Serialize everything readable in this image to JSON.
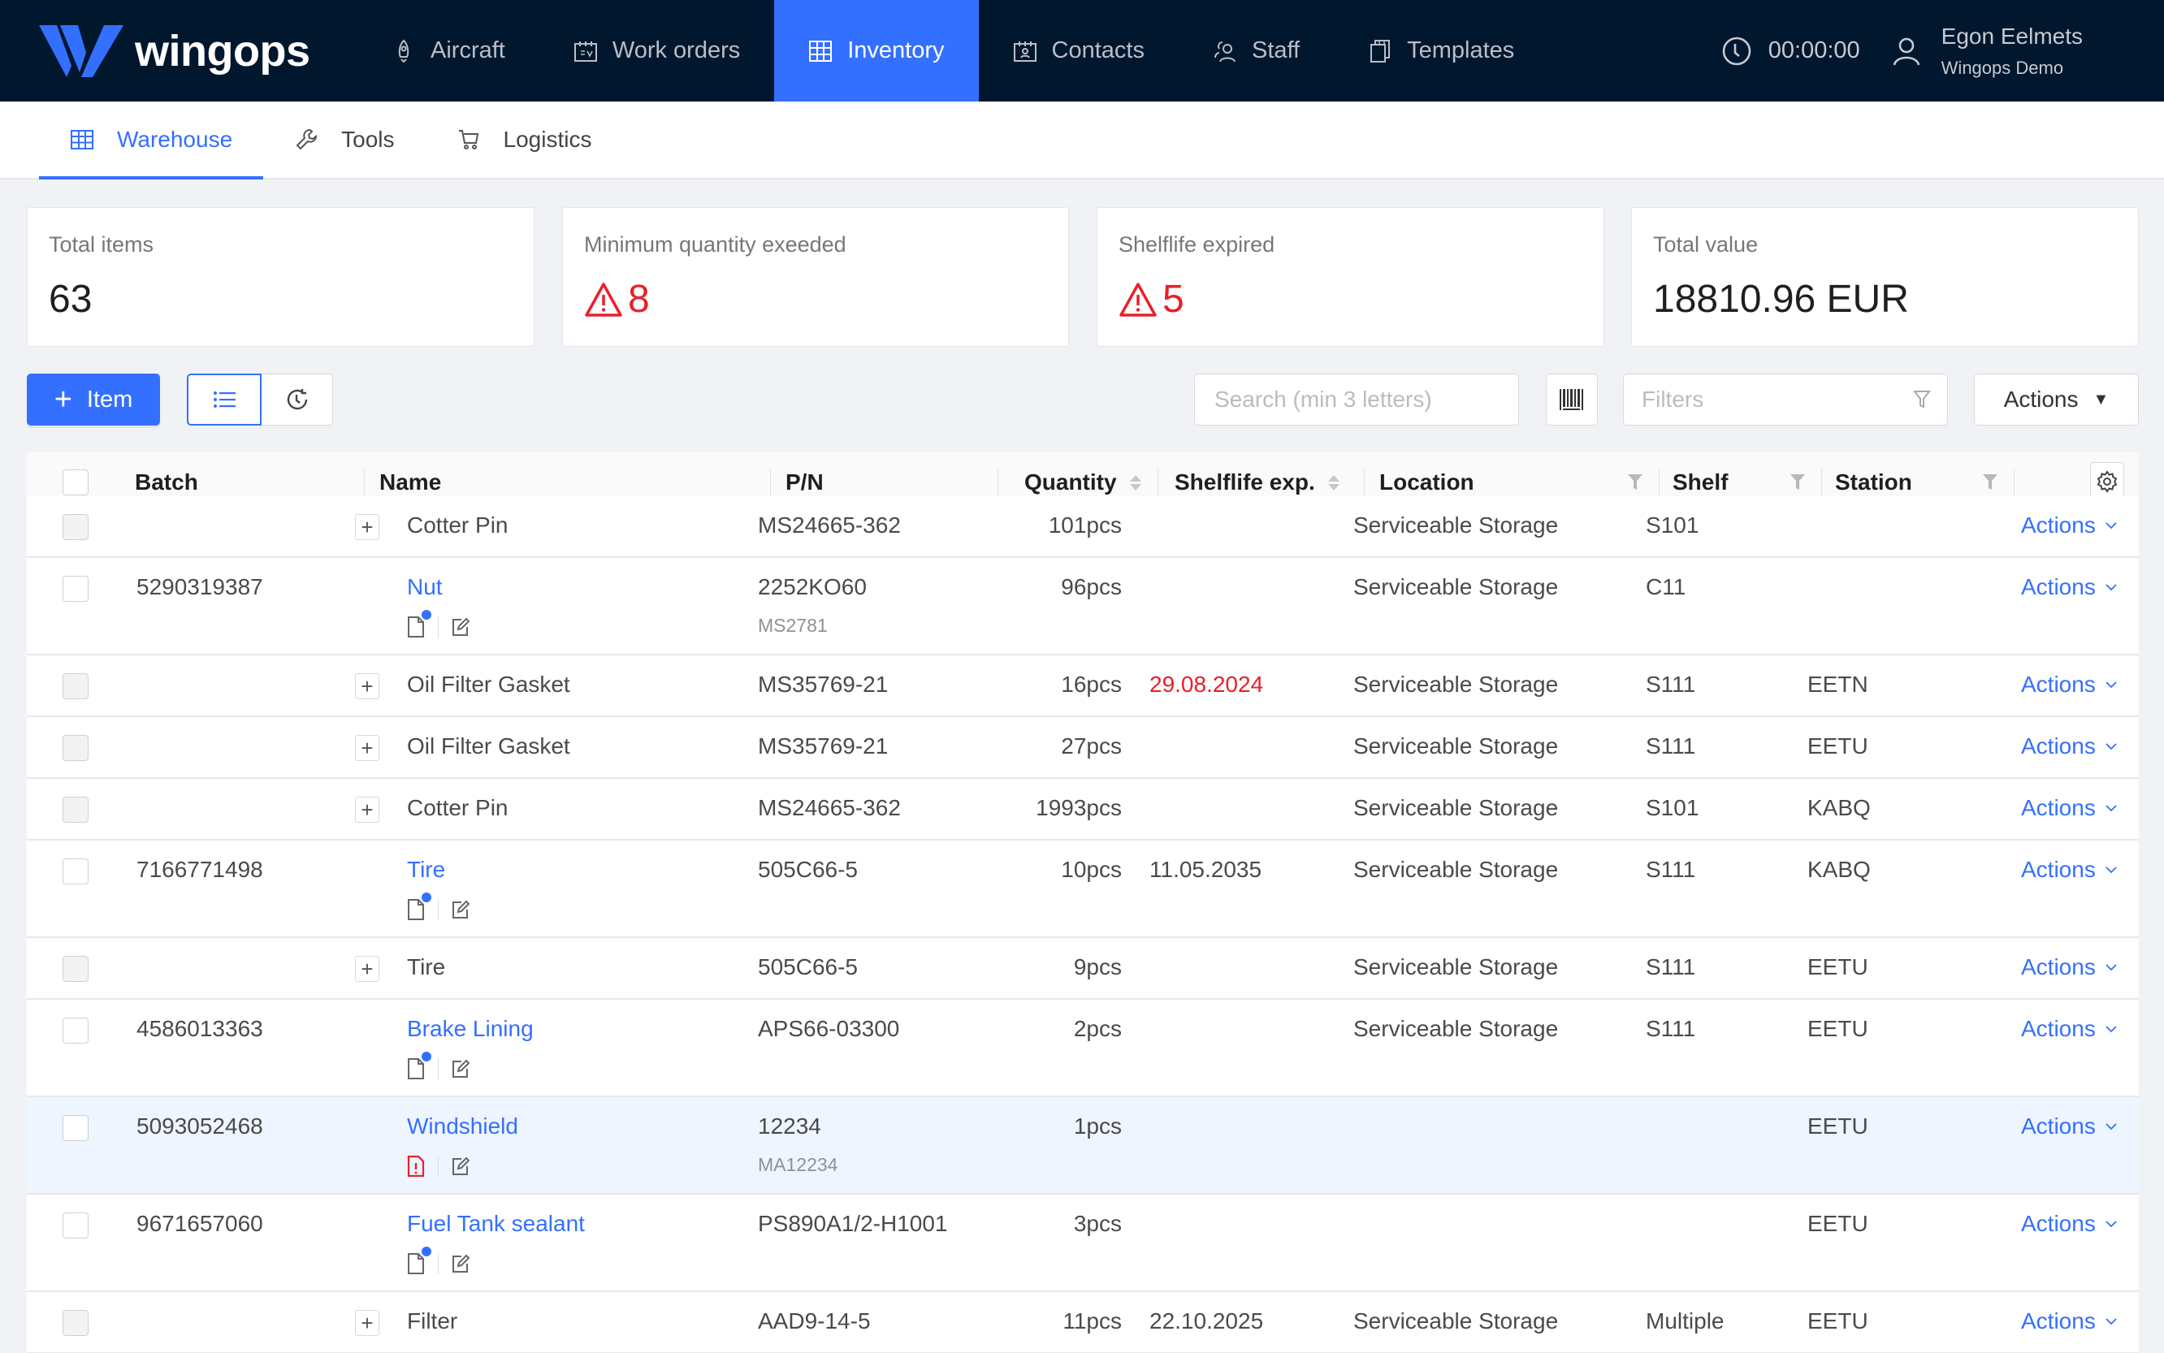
{
  "header": {
    "brand": "wingops",
    "nav": [
      {
        "label": "Aircraft",
        "icon": "rocket-icon",
        "active": false
      },
      {
        "label": "Work orders",
        "icon": "calendar-icon",
        "active": false
      },
      {
        "label": "Inventory",
        "icon": "grid-icon",
        "active": true
      },
      {
        "label": "Contacts",
        "icon": "contact-card-icon",
        "active": false
      },
      {
        "label": "Staff",
        "icon": "users-icon",
        "active": false
      },
      {
        "label": "Templates",
        "icon": "copy-icon",
        "active": false
      }
    ],
    "timer": "00:00:00",
    "user": {
      "name": "Egon Eelmets",
      "org": "Wingops Demo"
    }
  },
  "subtabs": [
    {
      "label": "Warehouse",
      "icon": "grid-icon",
      "active": true
    },
    {
      "label": "Tools",
      "icon": "wrench-icon",
      "active": false
    },
    {
      "label": "Logistics",
      "icon": "cart-icon",
      "active": false
    }
  ],
  "cards": [
    {
      "label": "Total items",
      "value": "63",
      "warning": false
    },
    {
      "label": "Minimum quantity exeeded",
      "value": "8",
      "warning": true
    },
    {
      "label": "Shelflife expired",
      "value": "5",
      "warning": true
    },
    {
      "label": "Total value",
      "value": "18810.96 EUR",
      "warning": false
    }
  ],
  "toolbar": {
    "add_item_label": "Item",
    "search_placeholder": "Search (min 3 letters)",
    "filters_placeholder": "Filters",
    "actions_label": "Actions"
  },
  "table": {
    "columns": [
      "Batch",
      "Name",
      "P/N",
      "Quantity",
      "Shelflife exp.",
      "Location",
      "Shelf",
      "Station"
    ],
    "row_actions_label": "Actions",
    "rows": [
      {
        "type": "child",
        "batch": "",
        "name": "Cotter Pin",
        "pn": "MS24665-362",
        "pn_sub": "",
        "qty": "101pcs",
        "shelflife": "",
        "shelflife_expired": false,
        "location": "Serviceable Storage",
        "shelf": "S101",
        "station": ""
      },
      {
        "type": "parent",
        "batch": "5290319387",
        "name": "Nut",
        "doc_status": "has-docs",
        "pn": "2252KO60",
        "pn_sub": "MS2781",
        "qty": "96pcs",
        "shelflife": "",
        "shelflife_expired": false,
        "location": "Serviceable Storage",
        "shelf": "C11",
        "station": ""
      },
      {
        "type": "child",
        "batch": "",
        "name": "Oil Filter Gasket",
        "pn": "MS35769-21",
        "pn_sub": "",
        "qty": "16pcs",
        "shelflife": "29.08.2024",
        "shelflife_expired": true,
        "location": "Serviceable Storage",
        "shelf": "S111",
        "station": "EETN"
      },
      {
        "type": "child",
        "batch": "",
        "name": "Oil Filter Gasket",
        "pn": "MS35769-21",
        "pn_sub": "",
        "qty": "27pcs",
        "shelflife": "",
        "shelflife_expired": false,
        "location": "Serviceable Storage",
        "shelf": "S111",
        "station": "EETU"
      },
      {
        "type": "child",
        "batch": "",
        "name": "Cotter Pin",
        "pn": "MS24665-362",
        "pn_sub": "",
        "qty": "1993pcs",
        "shelflife": "",
        "shelflife_expired": false,
        "location": "Serviceable Storage",
        "shelf": "S101",
        "station": "KABQ"
      },
      {
        "type": "parent",
        "batch": "7166771498",
        "name": "Tire",
        "doc_status": "has-docs",
        "pn": "505C66-5",
        "pn_sub": "",
        "qty": "10pcs",
        "shelflife": "11.05.2035",
        "shelflife_expired": false,
        "location": "Serviceable Storage",
        "shelf": "S111",
        "station": "KABQ"
      },
      {
        "type": "child",
        "batch": "",
        "name": "Tire",
        "pn": "505C66-5",
        "pn_sub": "",
        "qty": "9pcs",
        "shelflife": "",
        "shelflife_expired": false,
        "location": "Serviceable Storage",
        "shelf": "S111",
        "station": "EETU"
      },
      {
        "type": "parent",
        "batch": "4586013363",
        "name": "Brake Lining",
        "doc_status": "has-docs",
        "pn": "APS66-03300",
        "pn_sub": "",
        "qty": "2pcs",
        "shelflife": "",
        "shelflife_expired": false,
        "location": "Serviceable Storage",
        "shelf": "S111",
        "station": "EETU"
      },
      {
        "type": "parent",
        "batch": "5093052468",
        "name": "Windshield",
        "doc_status": "missing-docs",
        "highlight": true,
        "pn": "12234",
        "pn_sub": "MA12234",
        "qty": "1pcs",
        "shelflife": "",
        "shelflife_expired": false,
        "location": "",
        "shelf": "",
        "station": "EETU"
      },
      {
        "type": "parent",
        "batch": "9671657060",
        "name": "Fuel Tank sealant",
        "doc_status": "has-docs",
        "pn": "PS890A1/2-H1001",
        "pn_sub": "",
        "qty": "3pcs",
        "shelflife": "",
        "shelflife_expired": false,
        "location": "",
        "shelf": "",
        "station": "EETU"
      },
      {
        "type": "child",
        "batch": "",
        "name": "Filter",
        "pn": "AAD9-14-5",
        "pn_sub": "",
        "qty": "11pcs",
        "shelflife": "22.10.2025",
        "shelflife_expired": false,
        "location": "Serviceable Storage",
        "shelf": "Multiple",
        "station": "EETU"
      }
    ]
  },
  "colors": {
    "header_bg": "#01172e",
    "accent": "#3470ff",
    "danger": "#e8202a",
    "highlight_row": "#eef5ff",
    "page_bg": "#f0f2f5"
  }
}
